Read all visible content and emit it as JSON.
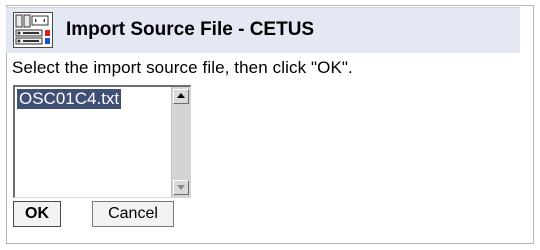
{
  "dialog": {
    "title": "Import Source File - CETUS",
    "title_icon": "hardware-console-icon",
    "instruction": "Select the import source file, then click \"OK\".",
    "file_list": {
      "items": [
        {
          "label": "OSC01C4.txt",
          "selected": true
        }
      ]
    },
    "buttons": {
      "ok_label": "OK",
      "cancel_label": "Cancel"
    }
  },
  "colors": {
    "titlebar_bg": "#e3e8f3",
    "selection_bg": "#3f4f76",
    "selection_fg": "#ffffff"
  }
}
